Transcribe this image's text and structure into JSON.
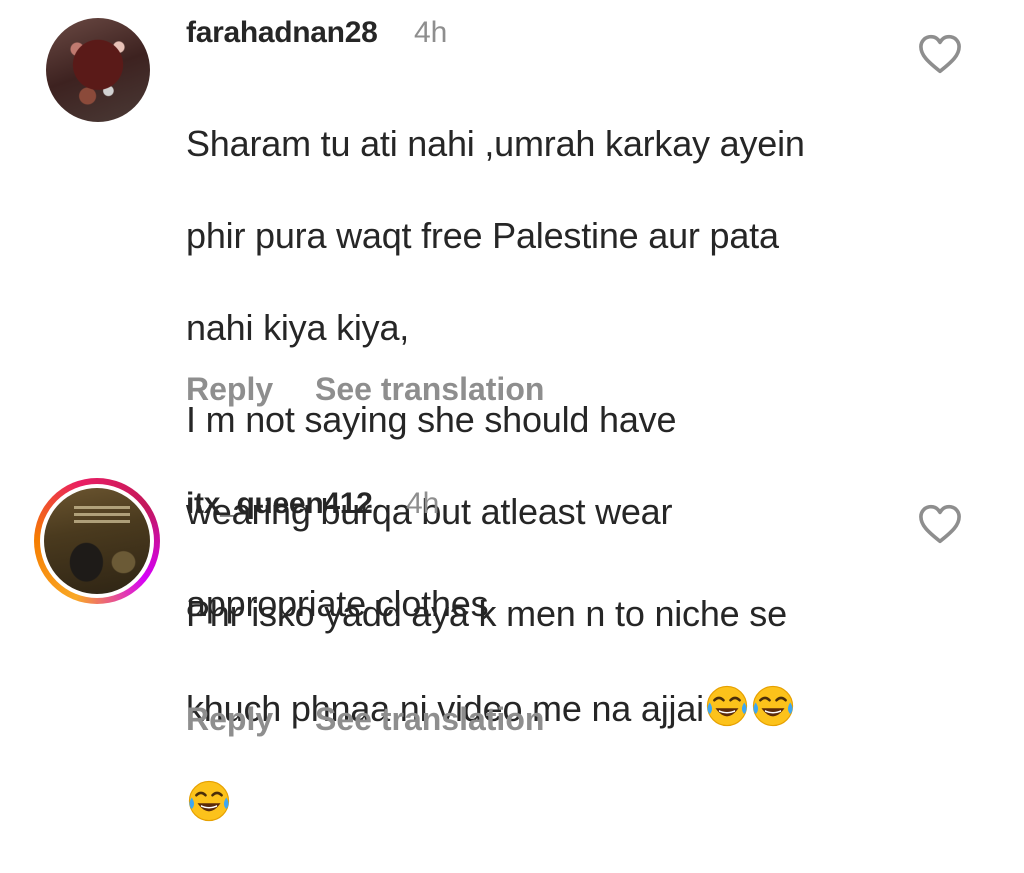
{
  "comments": [
    {
      "username": "farahadnan28",
      "time": "4h",
      "lines": [
        "Sharam tu ati nahi ,umrah karkay ayein",
        "phir pura waqt free Palestine aur pata",
        "nahi kiya kiya,",
        "I m not saying she should have",
        "wearing burqa but atleast wear",
        "appropriate clothes"
      ],
      "reply_label": "Reply",
      "translate_label": "See translation",
      "like_icon": "heart-outline-icon"
    },
    {
      "username": "itx_queen412",
      "time": "4h",
      "lines": [
        "Phr isko yadd aya k men n to niche se",
        "khuch phnaa ni video me na ajjai"
      ],
      "emoji": "face-with-tears-of-joy",
      "emoji_count": 3,
      "reply_label": "Reply",
      "translate_label": "See translation",
      "like_icon": "heart-outline-icon",
      "has_story_ring": true
    }
  ],
  "colors": {
    "text": "#262626",
    "secondary": "#8e8e8e",
    "background": "#ffffff"
  }
}
